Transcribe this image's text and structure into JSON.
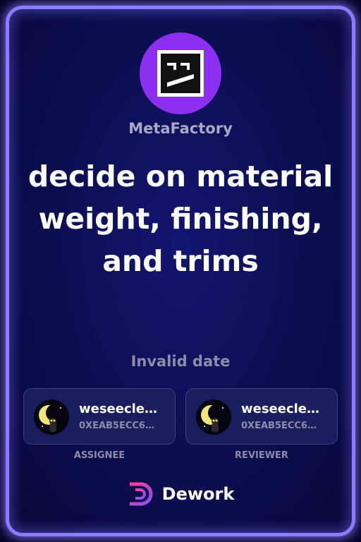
{
  "organization": {
    "name": "MetaFactory",
    "logo_icon": "robot-face-icon",
    "logo_color": "#8b2ff0"
  },
  "task": {
    "title": "decide on material weight, finishing, and trims",
    "date": "Invalid date"
  },
  "assignee": {
    "name": "weseecle…",
    "address": "0XEAB5ECC6…",
    "role_label": "ASSIGNEE",
    "avatar_icon": "moon-avatar-icon"
  },
  "reviewer": {
    "name": "weseecle…",
    "address": "0XEAB5ECC6…",
    "role_label": "REVIEWER",
    "avatar_icon": "moon-avatar-icon"
  },
  "brand": {
    "name": "Dework",
    "icon": "dework-logo-icon"
  },
  "colors": {
    "card_border": "#8a7bff",
    "card_bg": "#0d0f55",
    "muted_text": "#8d8daa"
  }
}
